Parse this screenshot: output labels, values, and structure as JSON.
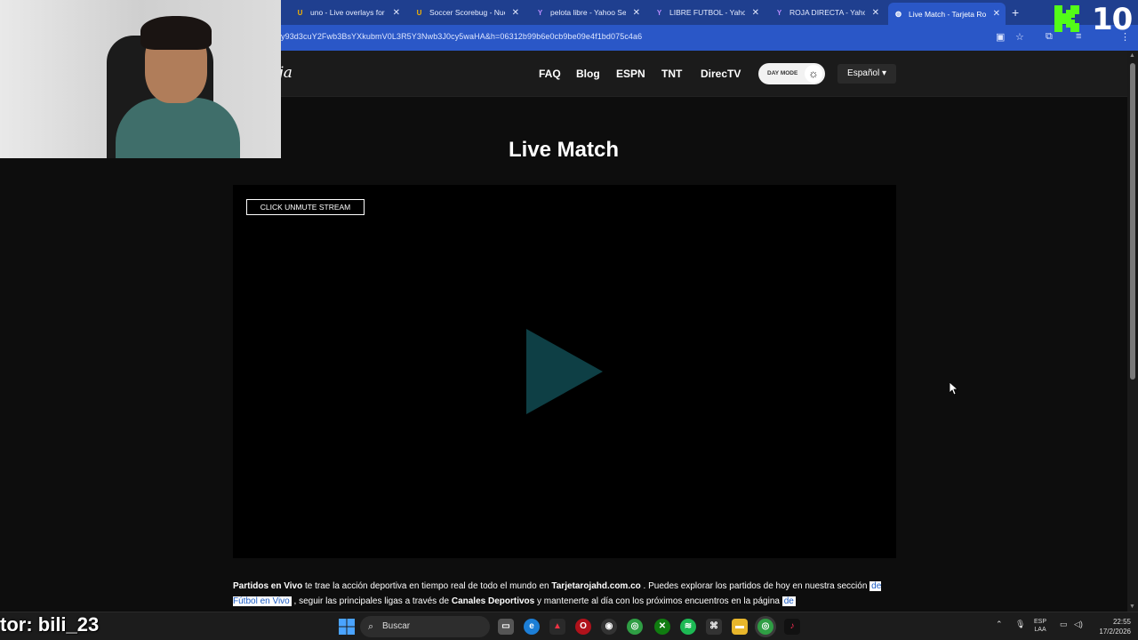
{
  "browser": {
    "tabs": [
      {
        "title": "uno - Live overlays for st",
        "icon": "uno-icon",
        "color": "#f5b400"
      },
      {
        "title": "Soccer Scorebug - Nuev",
        "icon": "uno-icon",
        "color": "#f5b400"
      },
      {
        "title": "pelota libre - Yahoo Sea",
        "icon": "yahoo-icon",
        "color": "#7b2cf0"
      },
      {
        "title": "LIBRE FUTBOL - Yahoo S",
        "icon": "yahoo-icon",
        "color": "#7b2cf0"
      },
      {
        "title": "ROJA DIRECTA - Yahoo S",
        "icon": "yahoo-icon",
        "color": "#7b2cf0"
      },
      {
        "title": "Live Match - Tarjeta Roja",
        "icon": "globe-icon",
        "color": "#ffffff",
        "active": true
      }
    ],
    "url": "y93d3cuY2Fwb3BsYXkubmV0L3R5Y3Nwb3J0cy5waHA&h=06312b99b6e0cb9be09e4f1bd075c4a6"
  },
  "site": {
    "logo_text": "eta Roja",
    "nav": [
      "FAQ",
      "Blog",
      "ESPN",
      "TNT",
      "DirecTV"
    ],
    "day_mode_label": "DAY MODE",
    "language": "Español ▾"
  },
  "main": {
    "title": "Live Match",
    "unmute_label": "CLICK UNMUTE STREAM",
    "desc": {
      "b1": "Partidos en Vivo",
      "t1": "  te trae la acción deportiva en tiempo real de todo el mundo en  ",
      "b2": "Tarjetarojahd.com.co",
      "t2": " . Puedes explorar los partidos de hoy en nuestra sección ",
      "link1": "de Fútbol en Vivo",
      "t3": " , seguir las principales ligas a través de  ",
      "b3": "Canales Deportivos",
      "t4": " y mantenerte al día con los próximos encuentros en la  página ",
      "link2": "de"
    }
  },
  "overlay": {
    "streamer_text": "tor: bili_23",
    "badge_number": "10"
  },
  "taskbar": {
    "search_label": "Buscar",
    "lang_top": "ESP",
    "lang_bottom": "LAA",
    "time": "22:55",
    "date": "17/2/2026"
  }
}
